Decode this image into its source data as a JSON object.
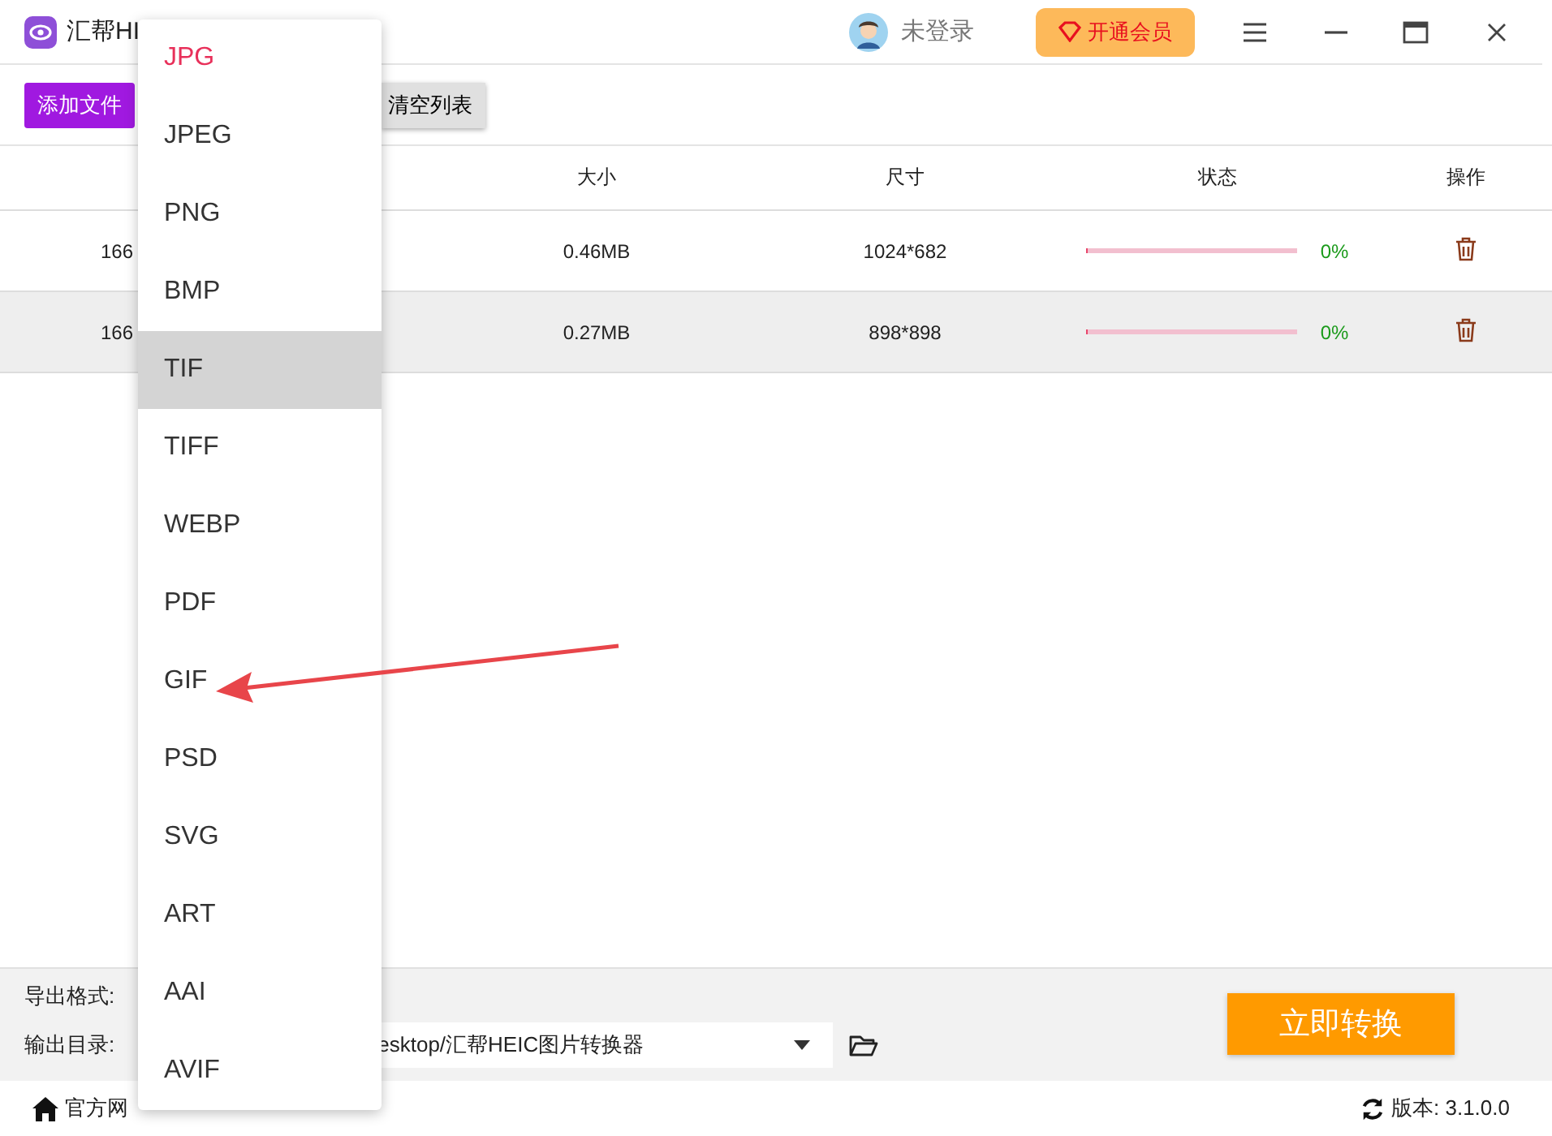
{
  "app": {
    "title": "汇帮HI",
    "user": "未登录",
    "vip_button": "开通会员"
  },
  "toolbar": {
    "add_button": "添加文件",
    "clear_button": "清空列表"
  },
  "table": {
    "columns": [
      "大小",
      "尺寸",
      "状态",
      "操作"
    ],
    "rows": [
      {
        "name": "166",
        "size": "0.46MB",
        "dimensions": "1024*682",
        "level": 0,
        "progress": "0%",
        "selected": false
      },
      {
        "name": "166",
        "size": "0.27MB",
        "dimensions": "898*898",
        "level": 0,
        "progress": "0%",
        "selected": true
      }
    ]
  },
  "bottom": {
    "format_label": "导出格式:",
    "output_label": "输出目录:",
    "output_value": "esktop/汇帮HEIC图片转换器",
    "convert_button": "立即转换"
  },
  "footer": {
    "website": "官方网",
    "version": "版本:  3.1.0.0"
  },
  "format_menu": [
    {
      "label": "JPG",
      "selected": true,
      "hovered": false
    },
    {
      "label": "JPEG",
      "selected": false,
      "hovered": false
    },
    {
      "label": "PNG",
      "selected": false,
      "hovered": false
    },
    {
      "label": "BMP",
      "selected": false,
      "hovered": false
    },
    {
      "label": "TIF",
      "selected": false,
      "hovered": true
    },
    {
      "label": "TIFF",
      "selected": false,
      "hovered": false
    },
    {
      "label": "WEBP",
      "selected": false,
      "hovered": false
    },
    {
      "label": "PDF",
      "selected": false,
      "hovered": false
    },
    {
      "label": "GIF",
      "selected": false,
      "hovered": false
    },
    {
      "label": "PSD",
      "selected": false,
      "hovered": false
    },
    {
      "label": "SVG",
      "selected": false,
      "hovered": false
    },
    {
      "label": "ART",
      "selected": false,
      "hovered": false
    },
    {
      "label": "AAI",
      "selected": false,
      "hovered": false
    },
    {
      "label": "AVIF",
      "selected": false,
      "hovered": false
    }
  ]
}
